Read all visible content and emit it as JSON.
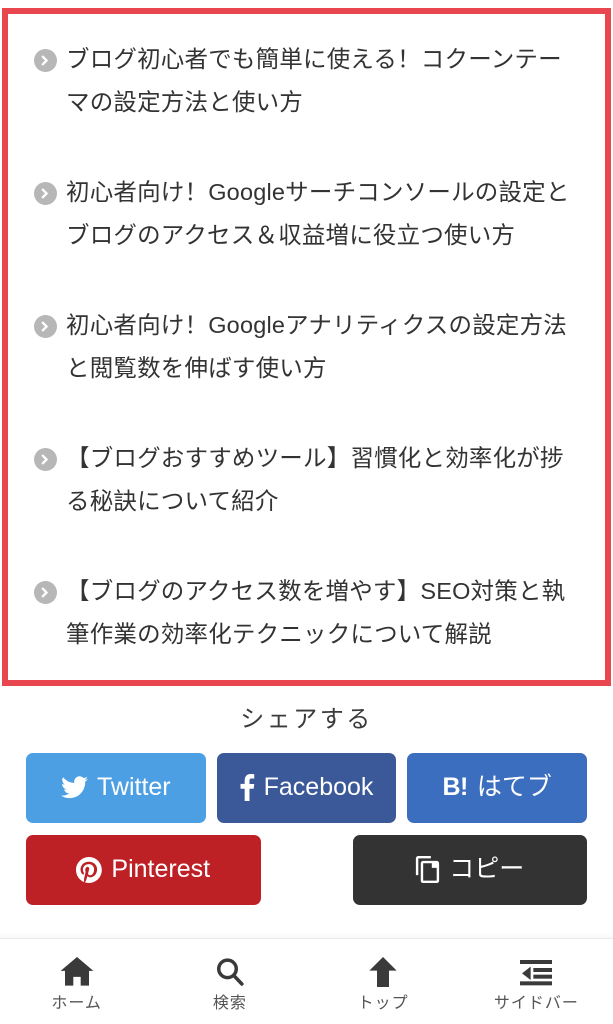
{
  "related": {
    "border_color": "#e8474f",
    "bullet_color": "#b7b7b7",
    "items": [
      {
        "text": "ブログ初心者でも簡単に使える！コクーンテーマの設定方法と使い方",
        "icon": "chevron-circle-right-icon"
      },
      {
        "text": "初心者向け！Googleサーチコンソールの設定とブログのアクセス＆収益増に役立つ使い方",
        "icon": "chevron-circle-right-icon"
      },
      {
        "text": "初心者向け！Googleアナリティクスの設定方法と閲覧数を伸ばす使い方",
        "icon": "chevron-circle-right-icon"
      },
      {
        "text": "【ブログおすすめツール】習慣化と効率化が捗る秘訣について紹介",
        "icon": "chevron-circle-right-icon"
      },
      {
        "text": "【ブログのアクセス数を増やす】SEO対策と執筆作業の効率化テクニックについて解説",
        "icon": "chevron-circle-right-icon"
      }
    ]
  },
  "share": {
    "title": "シェアする",
    "buttons": [
      {
        "label": "Twitter",
        "icon": "twitter-icon",
        "color": "#4d9fe3"
      },
      {
        "label": "Facebook",
        "icon": "facebook-icon",
        "color": "#3b5998"
      },
      {
        "label": "はてブ",
        "icon": "hatena-icon",
        "badge": "B!",
        "color": "#3c6ec0"
      },
      {
        "label": "Pinterest",
        "icon": "pinterest-icon",
        "color": "#bd2126"
      },
      {
        "label": "コピー",
        "icon": "copy-icon",
        "color": "#333333"
      }
    ]
  },
  "bottom_nav": {
    "items": [
      {
        "label": "ホーム",
        "icon": "home-icon"
      },
      {
        "label": "検索",
        "icon": "search-icon"
      },
      {
        "label": "トップ",
        "icon": "arrow-up-icon"
      },
      {
        "label": "サイドバー",
        "icon": "sidebar-indent-icon"
      }
    ]
  }
}
